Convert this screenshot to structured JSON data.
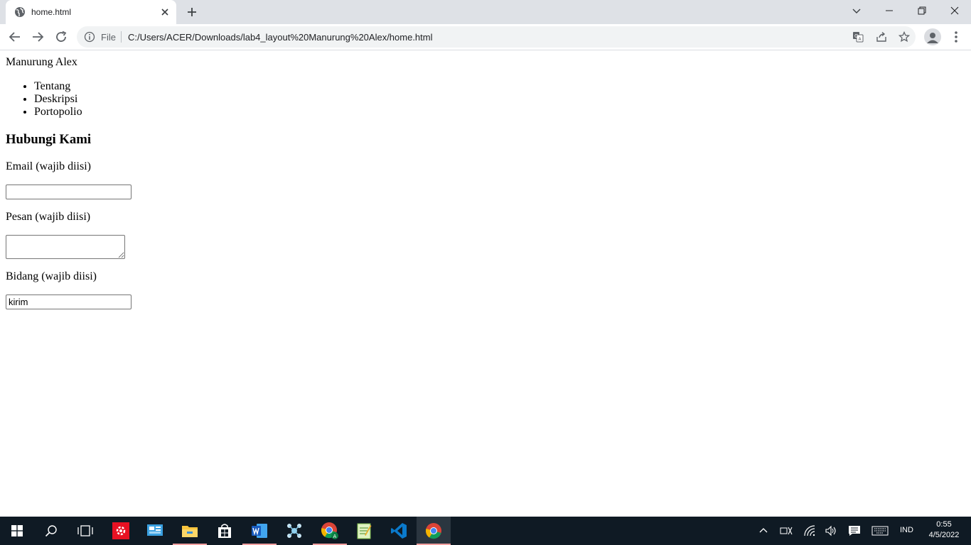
{
  "browser": {
    "tab_title": "home.html",
    "address_prefix": "File",
    "url": "C:/Users/ACER/Downloads/lab4_layout%20Manurung%20Alex/home.html"
  },
  "page": {
    "site_name": "Manurung Alex",
    "nav_items": [
      "Tentang",
      "Deskripsi",
      "Portopolio"
    ],
    "heading": "Hubungi Kami",
    "email_label": "Email (wajib diisi)",
    "email_value": "",
    "message_label": "Pesan (wajib diisi)",
    "field_label": "Bidang (wajib diisi)",
    "field_value": "kirim"
  },
  "taskbar": {
    "language": "IND",
    "time": "0:55",
    "date": "4/5/2022"
  },
  "colors": {
    "tabstrip": "#dee1e6",
    "omnibox": "#f1f3f4",
    "taskbar": "#0f1a24",
    "running_indicator": "#f2a0a0"
  },
  "icons": [
    "globe-icon",
    "close-icon",
    "plus-icon",
    "chevron-down-icon",
    "minimize-icon",
    "restore-icon",
    "back-arrow-icon",
    "forward-arrow-icon",
    "reload-icon",
    "info-icon",
    "translate-icon",
    "share-icon",
    "star-icon",
    "profile-icon",
    "kebab-menu-icon",
    "windows-start-icon",
    "search-icon",
    "task-view-icon",
    "settings-app-icon",
    "control-panel-icon",
    "file-explorer-icon",
    "store-icon",
    "word-icon",
    "network-app-icon",
    "chrome-profile-icon",
    "notepad-icon",
    "vscode-icon",
    "chrome-icon",
    "chevron-up-icon",
    "keyboard-layout-icon",
    "wifi-icon",
    "volume-icon",
    "notification-icon",
    "touch-keyboard-icon"
  ]
}
